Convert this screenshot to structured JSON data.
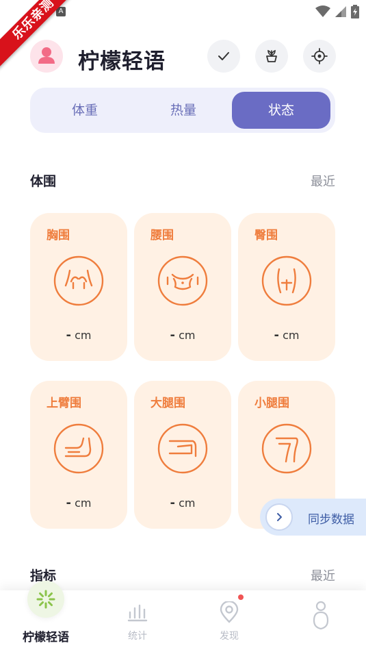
{
  "status_bar": {
    "badge": "乐乐亲测",
    "app_indicator": "A"
  },
  "header": {
    "title": "柠檬轻语"
  },
  "tabs": [
    {
      "label": "体重",
      "active": false
    },
    {
      "label": "热量",
      "active": false
    },
    {
      "label": "状态",
      "active": true
    }
  ],
  "girth_section": {
    "title": "体围",
    "more": "最近",
    "cards": [
      {
        "label": "胸围",
        "value": "-",
        "unit": "cm",
        "icon": "chest-icon"
      },
      {
        "label": "腰围",
        "value": "-",
        "unit": "cm",
        "icon": "waist-icon"
      },
      {
        "label": "臀围",
        "value": "-",
        "unit": "cm",
        "icon": "hip-icon"
      },
      {
        "label": "上臂围",
        "value": "-",
        "unit": "cm",
        "icon": "upper-arm-icon"
      },
      {
        "label": "大腿围",
        "value": "-",
        "unit": "cm",
        "icon": "thigh-icon"
      },
      {
        "label": "小腿围",
        "value": "",
        "unit": "",
        "icon": "calf-icon"
      }
    ]
  },
  "index_section": {
    "title": "指标",
    "more": "最近"
  },
  "sync": {
    "label": "同步数据"
  },
  "bottom_nav": [
    {
      "label": "柠檬轻语",
      "active": true,
      "icon": "lemon-icon"
    },
    {
      "label": "统计",
      "active": false,
      "icon": "stats-icon"
    },
    {
      "label": "发现",
      "active": false,
      "icon": "discover-icon",
      "badge": true
    },
    {
      "label": "",
      "active": false,
      "icon": "profile-icon"
    }
  ],
  "colors": {
    "accent": "#6a6cc4",
    "card_bg": "#fff1e4",
    "card_fg": "#ef7d3d",
    "avatar": "#f26b86"
  }
}
